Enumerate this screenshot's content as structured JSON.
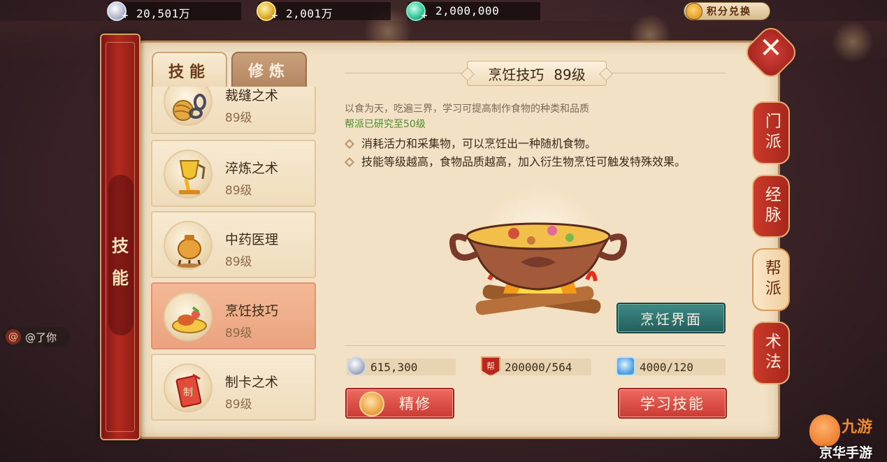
{
  "currencies": [
    {
      "name": "silver",
      "value": "20,501万",
      "icon": "silver-coin-icon"
    },
    {
      "name": "gold",
      "value": "2,001万",
      "icon": "gold-coin-icon"
    },
    {
      "name": "jade",
      "value": "2,000,000",
      "icon": "jade-icon"
    }
  ],
  "points_exchange": {
    "label": "积分兑换",
    "icon": "money-bag-icon"
  },
  "banner": {
    "label_1": "技",
    "label_2": "能"
  },
  "tabs": [
    {
      "label": "技能",
      "active": true
    },
    {
      "label": "修炼",
      "active": false
    }
  ],
  "skills": [
    {
      "name": "裁缝之术",
      "level": "89级",
      "icon": "tailoring-icon",
      "selected": false
    },
    {
      "name": "淬炼之术",
      "level": "89级",
      "icon": "refining-icon",
      "selected": false
    },
    {
      "name": "中药医理",
      "level": "89级",
      "icon": "medicine-icon",
      "selected": false
    },
    {
      "name": "烹饪技巧",
      "level": "89级",
      "icon": "cooking-icon",
      "selected": true
    },
    {
      "name": "制卡之术",
      "level": "89级",
      "icon": "card-making-icon",
      "selected": false
    }
  ],
  "detail": {
    "title": "烹饪技巧",
    "level": "89级",
    "description": "以食为天，吃遍三界，学习可提高制作食物的种类和品质",
    "guild_note": "帮派已研究至50级",
    "bullets": [
      "消耗活力和采集物，可以烹饪出一种随机食物。",
      "技能等级越高，食物品质越高，加入衍生物烹饪可触发特殊效果。"
    ],
    "illustration": "cooking-pot-icon",
    "cook_button": "烹饪界面"
  },
  "costs": {
    "silver": "615,300",
    "guild": "200000/564",
    "guild_badge": "帮",
    "energy": "4000/120"
  },
  "actions": {
    "refine": "精修",
    "learn": "学习技能"
  },
  "side_tabs": [
    {
      "label": "门派",
      "active": false
    },
    {
      "label": "经脉",
      "active": false
    },
    {
      "label": "帮派",
      "active": true
    },
    {
      "label": "术法",
      "active": false
    }
  ],
  "close": {
    "icon": "close-icon"
  },
  "chat": {
    "at": "@",
    "mention": "@了你"
  },
  "watermark": {
    "logo": "九游",
    "brand": "京华手游"
  },
  "colors": {
    "panel": "#f2e1c5",
    "banner": "#b12a20",
    "accent_teal": "#2f7470",
    "accent_red": "#d9483e",
    "guild_green": "#4c8c2a"
  }
}
